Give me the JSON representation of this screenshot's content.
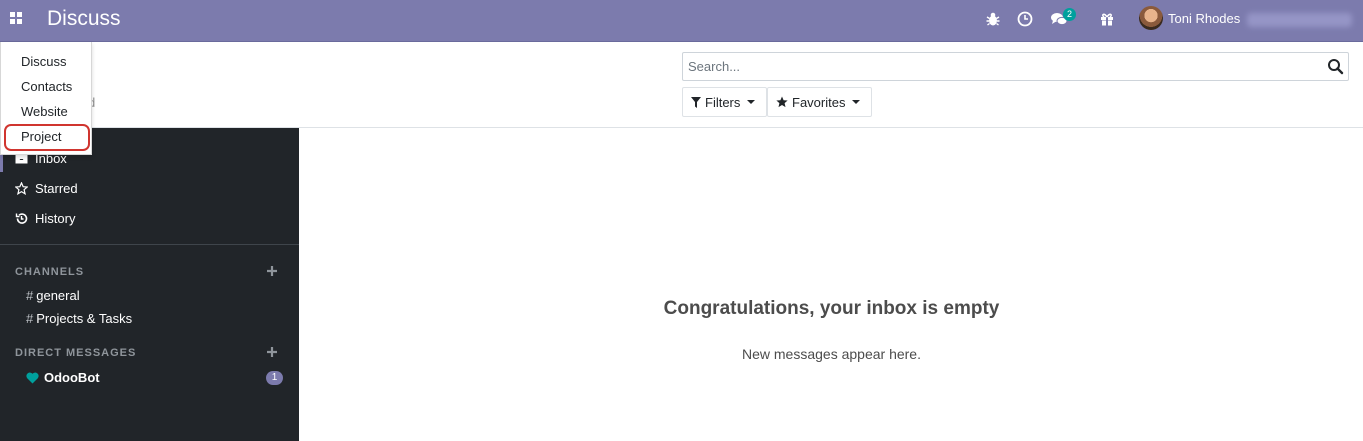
{
  "navbar": {
    "app_title": "Discuss",
    "chat_badge": "2",
    "user_name": "Toni Rhodes",
    "icons": [
      "apps-icon",
      "bug-icon",
      "clock-icon",
      "chat-icon",
      "gift-icon"
    ],
    "accent_color": "#7c7bad"
  },
  "app_menu": {
    "items": [
      "Discuss",
      "Contacts",
      "Website",
      "Project"
    ],
    "highlighted": "Project",
    "highlight_color": "#d0352f"
  },
  "control_panel": {
    "faded_text": "d",
    "search_placeholder": "Search...",
    "filters_label": "Filters",
    "favorites_label": "Favorites"
  },
  "sidebar": {
    "mailboxes": [
      {
        "label": "Inbox",
        "icon": "inbox-icon"
      },
      {
        "label": "Starred",
        "icon": "star-icon"
      },
      {
        "label": "History",
        "icon": "history-icon"
      }
    ],
    "channels_header": "CHANNELS",
    "channels": [
      "general",
      "Projects & Tasks"
    ],
    "hash": "#",
    "dm_header": "DIRECT MESSAGES",
    "dm": {
      "name": "OdooBot",
      "unread": "1",
      "status_color": "#00a09d"
    },
    "background": "#212529"
  },
  "main": {
    "empty_title": "Congratulations, your inbox is empty",
    "empty_subtitle": "New messages appear here."
  }
}
